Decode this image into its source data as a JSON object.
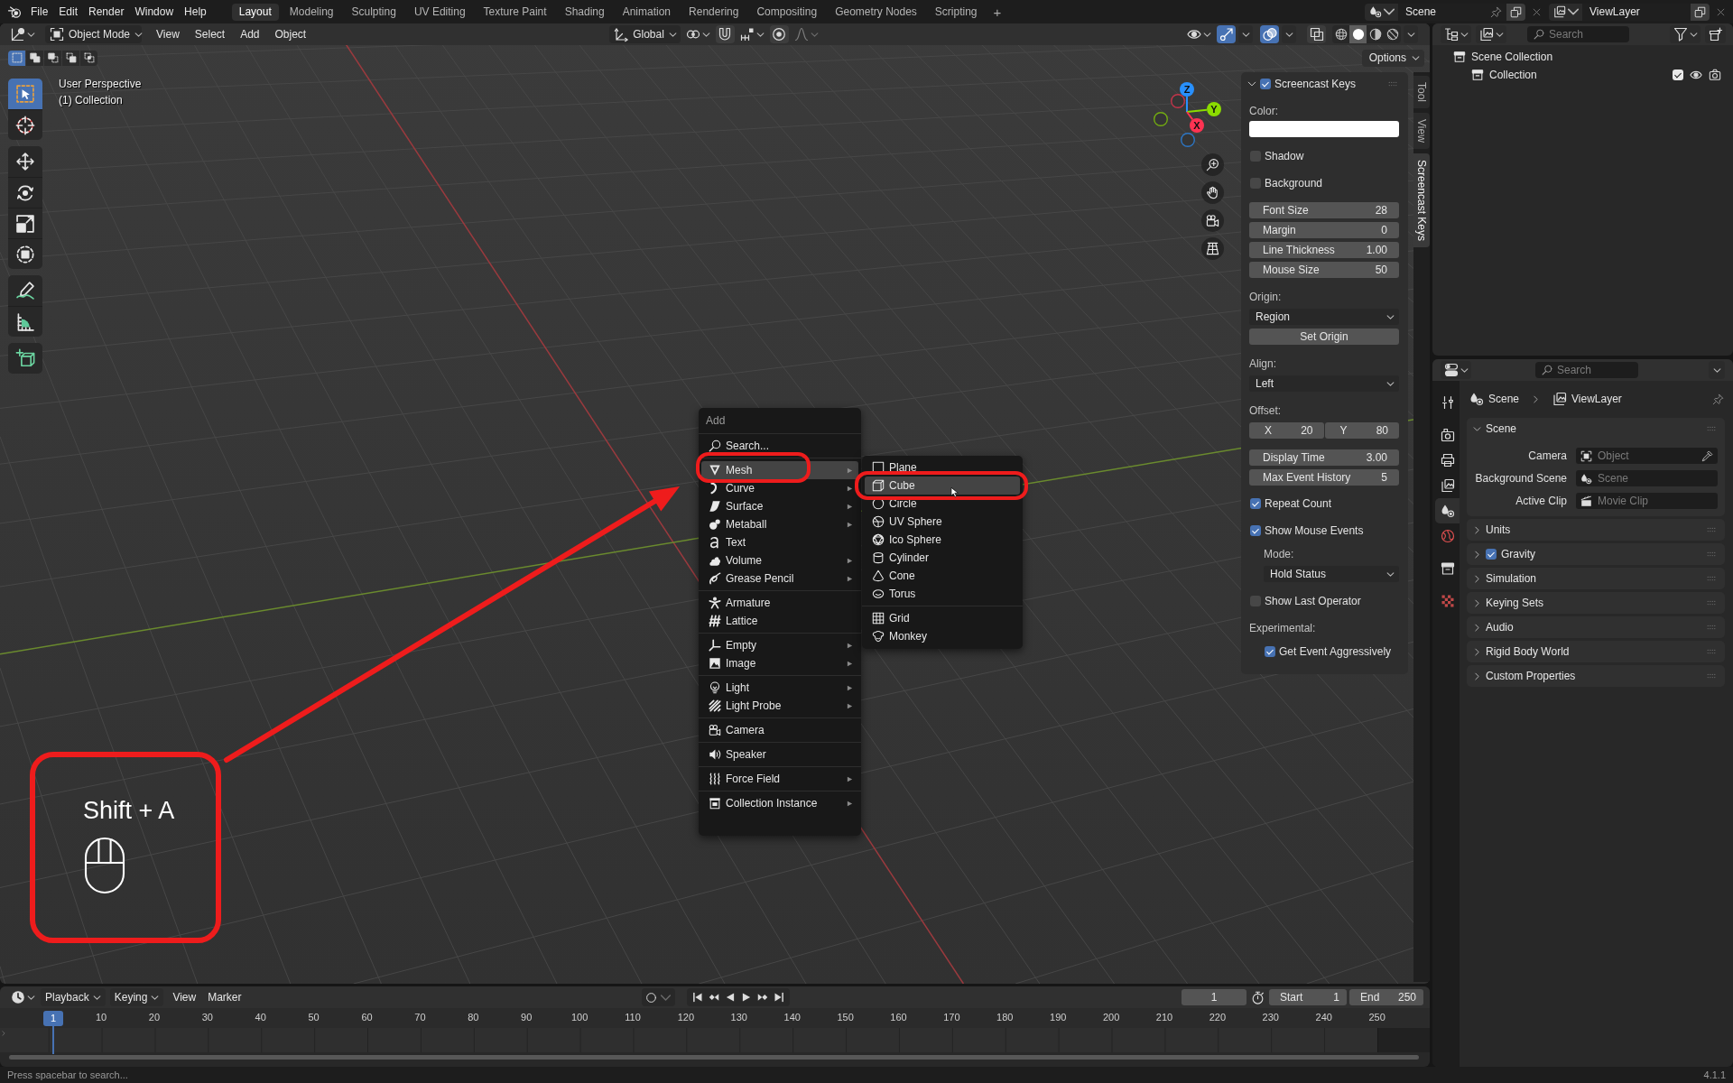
{
  "topbar": {
    "menus": [
      "File",
      "Edit",
      "Render",
      "Window",
      "Help"
    ],
    "workspaces": [
      {
        "label": "Layout",
        "selected": true
      },
      {
        "label": "Modeling",
        "selected": false
      },
      {
        "label": "Sculpting",
        "selected": false
      },
      {
        "label": "UV Editing",
        "selected": false
      },
      {
        "label": "Texture Paint",
        "selected": false
      },
      {
        "label": "Shading",
        "selected": false
      },
      {
        "label": "Animation",
        "selected": false
      },
      {
        "label": "Rendering",
        "selected": false
      },
      {
        "label": "Compositing",
        "selected": false
      },
      {
        "label": "Geometry Nodes",
        "selected": false
      },
      {
        "label": "Scripting",
        "selected": false
      }
    ],
    "add_workspace": "+",
    "scene": "Scene",
    "view_layer": "ViewLayer"
  },
  "viewport": {
    "header": {
      "mode": "Object Mode",
      "menus": [
        "View",
        "Select",
        "Add",
        "Object"
      ],
      "orientation": "Global",
      "snap": false,
      "proportional": false,
      "gizmos": true,
      "overlays": true,
      "xray": false,
      "shading": [
        {
          "kind": "wireframe",
          "selected": false
        },
        {
          "kind": "solid",
          "selected": true
        },
        {
          "kind": "material",
          "selected": false
        },
        {
          "kind": "rendered",
          "selected": false
        }
      ]
    },
    "select_modes": [
      {
        "kind": "new",
        "selected": true
      },
      {
        "kind": "extend",
        "selected": false
      },
      {
        "kind": "subtract",
        "selected": false
      },
      {
        "kind": "invert",
        "selected": false
      },
      {
        "kind": "intersect",
        "selected": false
      }
    ],
    "options": "Options",
    "info": [
      "User Perspective",
      "(1) Collection"
    ],
    "tools": [
      [
        {
          "kind": "select_box",
          "selected": true
        },
        {
          "kind": "cursor",
          "selected": false
        }
      ],
      [
        {
          "kind": "move",
          "selected": false
        },
        {
          "kind": "rotate",
          "selected": false
        },
        {
          "kind": "scale",
          "selected": false
        },
        {
          "kind": "transform",
          "selected": false
        }
      ],
      [
        {
          "kind": "annotate",
          "selected": false
        },
        {
          "kind": "measure",
          "selected": false
        }
      ],
      [
        {
          "kind": "add_cube",
          "selected": false
        }
      ]
    ],
    "gizmo": [
      {
        "kind": "neg_y"
      },
      {
        "kind": "neg_x"
      },
      {
        "kind": "neg_z"
      },
      {
        "kind": "z",
        "label": "Z"
      },
      {
        "kind": "y",
        "label": "Y"
      },
      {
        "kind": "x",
        "label": "X"
      }
    ],
    "keys": "Shift + A"
  },
  "sidebar": {
    "tabs": [
      {
        "label": "Tool",
        "selected": false
      },
      {
        "label": "View",
        "selected": false
      },
      {
        "label": "Screencast Keys",
        "selected": true
      }
    ],
    "panel": {
      "title": "Screencast Keys",
      "checked": true,
      "expanded": true,
      "rows": [
        {
          "kind": "label",
          "text": "Color:"
        },
        {
          "kind": "color",
          "color": "#ffffff"
        },
        {
          "kind": "checkbox",
          "label": "Shadow",
          "checked": false
        },
        {
          "kind": "checkbox",
          "label": "Background",
          "checked": false
        },
        {
          "kind": "number",
          "label": "Font Size",
          "value": "28"
        },
        {
          "kind": "number",
          "label": "Margin",
          "value": "0"
        },
        {
          "kind": "number",
          "label": "Line Thickness",
          "value": "1.00"
        },
        {
          "kind": "number",
          "label": "Mouse Size",
          "value": "50"
        },
        {
          "kind": "label",
          "text": "Origin:"
        },
        {
          "kind": "dropdown",
          "value": "Region"
        },
        {
          "kind": "button",
          "label": "Set Origin"
        },
        {
          "kind": "label",
          "text": "Align:"
        },
        {
          "kind": "dropdown",
          "value": "Left"
        },
        {
          "kind": "label",
          "text": "Offset:"
        },
        {
          "kind": "pair",
          "fields": [
            {
              "label": "X",
              "value": "20"
            },
            {
              "label": "Y",
              "value": "80"
            }
          ]
        },
        {
          "kind": "number",
          "label": "Display Time",
          "value": "3.00"
        },
        {
          "kind": "number",
          "label": "Max Event History",
          "value": "5"
        },
        {
          "kind": "checkbox",
          "label": "Repeat Count",
          "checked": true
        },
        {
          "kind": "checkbox",
          "label": "Show Mouse Events",
          "checked": true,
          "children": [
            {
              "kind": "label",
              "text": "Mode:"
            },
            {
              "kind": "dropdown",
              "value": "Hold Status"
            }
          ]
        },
        {
          "kind": "checkbox",
          "label": "Show Last Operator",
          "checked": false
        },
        {
          "kind": "label",
          "text": "Experimental:",
          "children": [
            {
              "kind": "checkbox",
              "label": "Get Event Aggressively",
              "checked": true
            }
          ]
        }
      ]
    }
  },
  "add_menu": {
    "title": "Add",
    "search": "Search...",
    "sections": [
      [
        {
          "label": "Mesh",
          "kind": "mesh",
          "submenu": true,
          "selected": true,
          "circled": true
        },
        {
          "label": "Curve",
          "kind": "curve",
          "submenu": true,
          "selected": false,
          "circled": false
        },
        {
          "label": "Surface",
          "kind": "surface",
          "submenu": true,
          "selected": false,
          "circled": false
        },
        {
          "label": "Metaball",
          "kind": "metaball",
          "submenu": true,
          "selected": false,
          "circled": false
        },
        {
          "label": "Text",
          "kind": "text",
          "submenu": false,
          "selected": false,
          "circled": false
        },
        {
          "label": "Volume",
          "kind": "volume",
          "submenu": true,
          "selected": false,
          "circled": false
        },
        {
          "label": "Grease Pencil",
          "kind": "grease_pencil",
          "submenu": true,
          "selected": false,
          "circled": false
        }
      ],
      [
        {
          "label": "Armature",
          "kind": "armature",
          "submenu": false,
          "selected": false,
          "circled": false
        },
        {
          "label": "Lattice",
          "kind": "lattice",
          "submenu": false,
          "selected": false,
          "circled": false
        }
      ],
      [
        {
          "label": "Empty",
          "kind": "empty",
          "submenu": true,
          "selected": false,
          "circled": false
        },
        {
          "label": "Image",
          "kind": "image",
          "submenu": true,
          "selected": false,
          "circled": false
        }
      ],
      [
        {
          "label": "Light",
          "kind": "light",
          "submenu": true,
          "selected": false,
          "circled": false
        },
        {
          "label": "Light Probe",
          "kind": "light_probe",
          "submenu": true,
          "selected": false,
          "circled": false
        }
      ],
      [
        {
          "label": "Camera",
          "kind": "camera",
          "submenu": false,
          "selected": false,
          "circled": false
        }
      ],
      [
        {
          "label": "Speaker",
          "kind": "speaker",
          "submenu": false,
          "selected": false,
          "circled": false
        }
      ],
      [
        {
          "label": "Force Field",
          "kind": "force_field",
          "submenu": true,
          "selected": false,
          "circled": false
        }
      ],
      [
        {
          "label": "Collection Instance",
          "kind": "collection_instance",
          "submenu": true,
          "selected": false,
          "circled": false
        }
      ]
    ]
  },
  "mesh_menu": {
    "sections": [
      [
        {
          "label": "Plane",
          "kind": "plane",
          "selected": false,
          "circled": false
        },
        {
          "label": "Cube",
          "kind": "cube",
          "selected": true,
          "circled": true
        },
        {
          "label": "Circle",
          "kind": "circle",
          "selected": false,
          "circled": false
        },
        {
          "label": "UV Sphere",
          "kind": "uv_sphere",
          "selected": false,
          "circled": false
        },
        {
          "label": "Ico Sphere",
          "kind": "ico_sphere",
          "selected": false,
          "circled": false
        },
        {
          "label": "Cylinder",
          "kind": "cylinder",
          "selected": false,
          "circled": false
        },
        {
          "label": "Cone",
          "kind": "cone",
          "selected": false,
          "circled": false
        },
        {
          "label": "Torus",
          "kind": "torus",
          "selected": false,
          "circled": false
        }
      ],
      [
        {
          "label": "Grid",
          "kind": "grid",
          "selected": false,
          "circled": false
        },
        {
          "label": "Monkey",
          "kind": "monkey",
          "selected": false,
          "circled": false
        }
      ]
    ]
  },
  "outliner": {
    "search_placeholder": "Search",
    "tree": [
      {
        "label": "Scene Collection",
        "children": [
          {
            "label": "Collection",
            "checked": true,
            "visible": true,
            "renderable": true
          }
        ]
      }
    ]
  },
  "properties": {
    "search_placeholder": "Search",
    "tabs": [
      [
        {
          "kind": "tool",
          "selected": false
        }
      ],
      [
        {
          "kind": "render",
          "selected": false
        },
        {
          "kind": "output",
          "selected": false
        },
        {
          "kind": "view_layer",
          "selected": false
        },
        {
          "kind": "scene",
          "selected": true
        },
        {
          "kind": "world",
          "selected": false
        }
      ],
      [
        {
          "kind": "collection",
          "selected": false
        }
      ],
      [
        {
          "kind": "texture",
          "selected": false
        }
      ]
    ],
    "breadcrumb": [
      {
        "kind": "scene",
        "label": "Scene"
      },
      {
        "kind": "view_layer",
        "label": "ViewLayer"
      }
    ],
    "panels": [
      {
        "title": "Scene",
        "expanded": true,
        "fields": [
          {
            "label": "Camera",
            "placeholder": "Object",
            "kind": "object"
          },
          {
            "label": "Background Scene",
            "placeholder": "Scene",
            "kind": "scene"
          },
          {
            "label": "Active Clip",
            "placeholder": "Movie Clip",
            "kind": "movie_clip"
          }
        ]
      },
      {
        "title": "Units",
        "expanded": false
      },
      {
        "title": "Gravity",
        "expanded": false,
        "checked": true
      },
      {
        "title": "Simulation",
        "expanded": false
      },
      {
        "title": "Keying Sets",
        "expanded": false
      },
      {
        "title": "Audio",
        "expanded": false
      },
      {
        "title": "Rigid Body World",
        "expanded": false
      },
      {
        "title": "Custom Properties",
        "expanded": false
      }
    ]
  },
  "timeline": {
    "menus": [
      {
        "label": "Playback",
        "dropdown": true
      },
      {
        "label": "Keying",
        "dropdown": true
      },
      {
        "label": "View",
        "dropdown": false
      },
      {
        "label": "Marker",
        "dropdown": false
      }
    ],
    "auto_keying": false,
    "frame": "1",
    "start_label": "Start",
    "start": "1",
    "end_label": "End",
    "end": "250",
    "ruler": [
      "10",
      "20",
      "30",
      "40",
      "50",
      "60",
      "70",
      "80",
      "90",
      "100",
      "110",
      "120",
      "130",
      "140",
      "150",
      "160",
      "170",
      "180",
      "190",
      "200",
      "210",
      "220",
      "230",
      "240",
      "250"
    ],
    "playhead": "1"
  },
  "status_bar": {
    "hint": "Press spacebar to search...",
    "version": "4.1.1"
  }
}
